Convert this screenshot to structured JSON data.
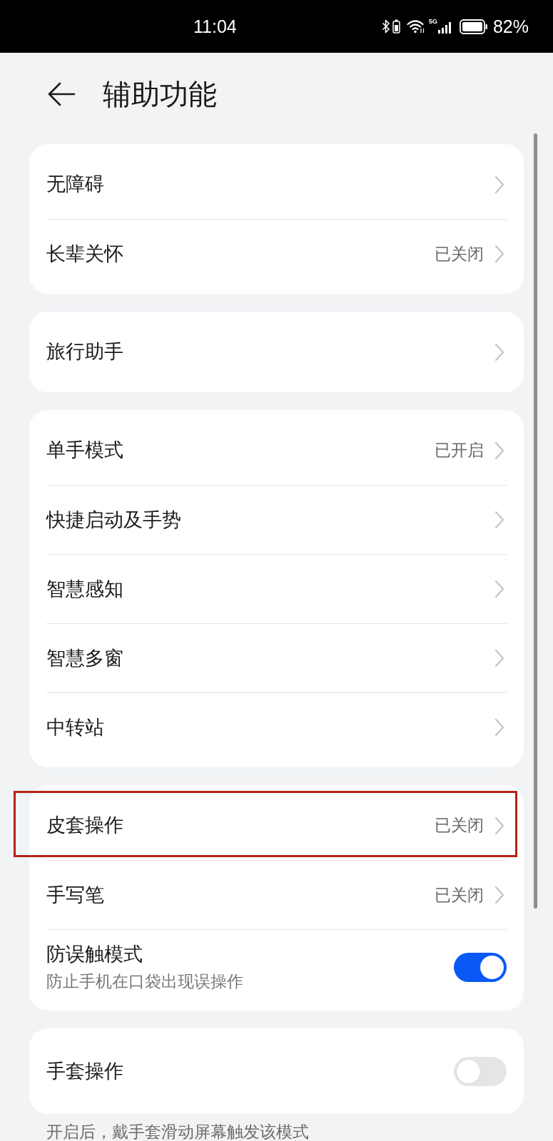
{
  "status_bar": {
    "time": "11:04",
    "network": "5G",
    "battery": "82%"
  },
  "header": {
    "title": "辅助功能"
  },
  "groups": [
    {
      "items": [
        {
          "kind": "link",
          "label": "无障碍",
          "highlighted": false
        },
        {
          "kind": "link",
          "label": "长辈关怀",
          "value": "已关闭",
          "highlighted": false
        }
      ]
    },
    {
      "items": [
        {
          "kind": "link",
          "label": "旅行助手",
          "highlighted": false
        }
      ]
    },
    {
      "items": [
        {
          "kind": "link",
          "label": "单手模式",
          "value": "已开启",
          "highlighted": false
        },
        {
          "kind": "link",
          "label": "快捷启动及手势",
          "highlighted": false
        },
        {
          "kind": "link",
          "label": "智慧感知",
          "highlighted": false
        },
        {
          "kind": "link",
          "label": "智慧多窗",
          "highlighted": false
        },
        {
          "kind": "link",
          "label": "中转站",
          "highlighted": false
        }
      ]
    },
    {
      "items": [
        {
          "kind": "link",
          "label": "皮套操作",
          "value": "已关闭",
          "highlighted": true
        },
        {
          "kind": "link",
          "label": "手写笔",
          "value": "已关闭",
          "highlighted": false
        },
        {
          "kind": "toggle",
          "label": "防误触模式",
          "description": "防止手机在口袋出现误操作",
          "on": true,
          "highlighted": false
        }
      ]
    },
    {
      "items": [
        {
          "kind": "toggle",
          "label": "手套操作",
          "on": false,
          "highlighted": false
        }
      ],
      "footnote": "开启后，戴手套滑动屏幕触发该模式"
    }
  ]
}
